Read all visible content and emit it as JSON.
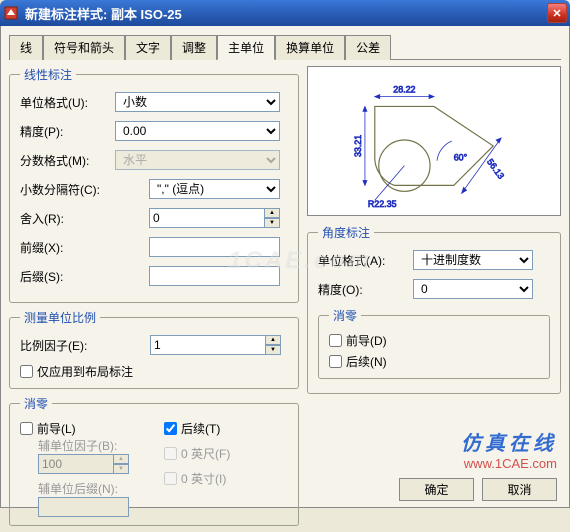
{
  "title": "新建标注样式: 副本 ISO-25",
  "tabs": [
    "线",
    "符号和箭头",
    "文字",
    "调整",
    "主单位",
    "换算单位",
    "公差"
  ],
  "active_tab": 4,
  "linear": {
    "legend": "线性标注",
    "unit_format_label": "单位格式(U):",
    "unit_format_value": "小数",
    "precision_label": "精度(P):",
    "precision_value": "0.00",
    "fraction_format_label": "分数格式(M):",
    "fraction_format_value": "水平",
    "decimal_sep_label": "小数分隔符(C):",
    "decimal_sep_value": "\",\" (逗点)",
    "roundoff_label": "舍入(R):",
    "roundoff_value": "0",
    "prefix_label": "前缀(X):",
    "prefix_value": "",
    "suffix_label": "后缀(S):",
    "suffix_value": ""
  },
  "scale": {
    "legend": "测量单位比例",
    "factor_label": "比例因子(E):",
    "factor_value": "1",
    "layout_only_label": "仅应用到布局标注"
  },
  "zero": {
    "legend": "消零",
    "leading_label": "前导(L)",
    "trailing_label": "后续(T)",
    "sub_factor_label": "辅单位因子(B):",
    "sub_factor_value": "100",
    "sub_suffix_label": "辅单位后缀(N):",
    "sub_suffix_value": "",
    "feet_label": "0 英尺(F)",
    "inches_label": "0 英寸(I)"
  },
  "preview": {
    "top_dim": "28.22",
    "left_dim": "33.21",
    "right_dim": "56.13",
    "radius_dim": "R22.35",
    "angle_dim": "60°"
  },
  "angular": {
    "legend": "角度标注",
    "unit_format_label": "单位格式(A):",
    "unit_format_value": "十进制度数",
    "precision_label": "精度(O):",
    "precision_value": "0",
    "zero_legend": "消零",
    "leading_label": "前导(D)",
    "trailing_label": "后续(N)"
  },
  "buttons": {
    "ok": "确定",
    "cancel": "取消"
  },
  "watermark": {
    "cn": "仿真在线",
    "url": "www.1CAE.com",
    "center": "1CAE.com"
  }
}
